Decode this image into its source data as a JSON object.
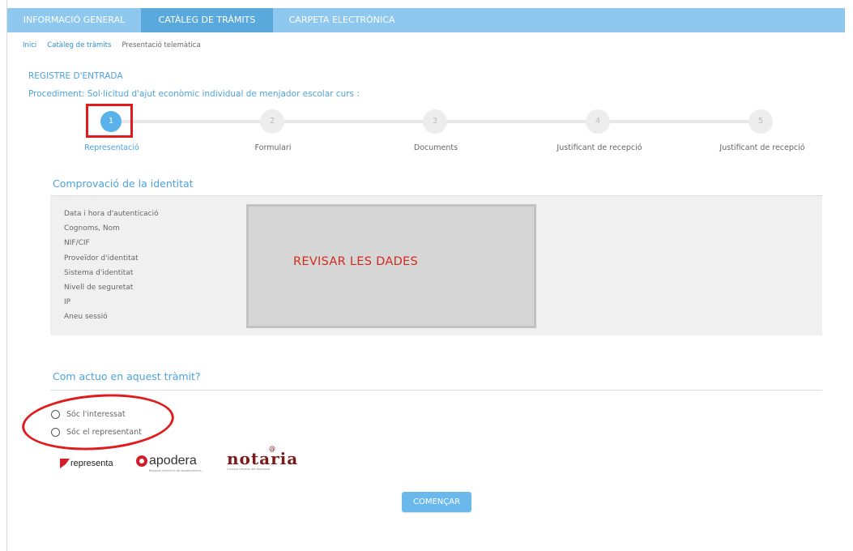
{
  "nav": {
    "tabs": [
      {
        "label": "INFORMACIÓ GENERAL"
      },
      {
        "label": "CATÀLEG DE TRÀMITS"
      },
      {
        "label": "CARPETA ELECTRÒNICA"
      }
    ],
    "active_tab": "CATÀLEG DE TRÀMITS"
  },
  "breadcrumb": {
    "items": [
      {
        "label": "Inici"
      },
      {
        "label": "Catàleg de tràmits"
      },
      {
        "label": "Presentació telemàtica"
      }
    ]
  },
  "header": {
    "title": "REGISTRE D'ENTRADA",
    "procedure": "Procediment: Sol·licitud d'ajut econòmic individual de menjador escolar curs :"
  },
  "stepper": {
    "current_step": 1,
    "steps": [
      {
        "number": "1",
        "label": "Representació"
      },
      {
        "number": "2",
        "label": "Formulari"
      },
      {
        "number": "3",
        "label": "Documents"
      },
      {
        "number": "4",
        "label": "Justificant de recepció"
      },
      {
        "number": "5",
        "label": "Justificant de recepció"
      }
    ]
  },
  "identity": {
    "title": "Comprovació de la identitat",
    "fields": [
      {
        "label": "Data i hora d'autenticació"
      },
      {
        "label": "Cognoms, Nom"
      },
      {
        "label": "NIF/CIF"
      },
      {
        "label": "Proveïdor d'identitat"
      },
      {
        "label": "Sistema d'identitat"
      },
      {
        "label": "Nivell de seguretat"
      },
      {
        "label": "IP"
      },
      {
        "label": "Aneu sessió"
      }
    ],
    "redacted_note": "REVISAR LES DADES"
  },
  "acting": {
    "title": "Com actuo en aquest tràmit?",
    "options": [
      {
        "label": "Sóc l'interessat"
      },
      {
        "label": "Sóc el representant"
      }
    ]
  },
  "logos": {
    "representa": "representa",
    "apodera": "apodera",
    "apodera_sub": "Registre electrònic de apoderaments",
    "notaria": "notaria",
    "notaria_sub": "Consejo General del Notariado"
  },
  "actions": {
    "start_label": "COMENÇAR"
  },
  "colors": {
    "nav_bg": "#8ec8ef",
    "nav_active": "#5aa9dd",
    "accent": "#4aa3df",
    "annotation_red": "#e01b1b",
    "button": "#6ab8ec"
  }
}
